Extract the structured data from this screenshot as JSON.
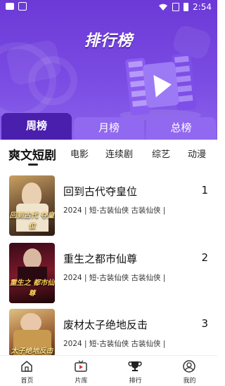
{
  "status_bar": {
    "time": "2:54"
  },
  "header": {
    "title": "排行榜"
  },
  "period_tabs": [
    {
      "label": "周榜",
      "active": true
    },
    {
      "label": "月榜",
      "active": false
    },
    {
      "label": "总榜",
      "active": false
    }
  ],
  "categories": [
    {
      "label": "爽文短剧",
      "active": true
    },
    {
      "label": "电影",
      "active": false
    },
    {
      "label": "连续剧",
      "active": false
    },
    {
      "label": "综艺",
      "active": false
    },
    {
      "label": "动漫",
      "active": false
    }
  ],
  "items": [
    {
      "title": "回到古代夺皇位",
      "rank": "1",
      "meta": "2024 | 短-古装仙侠 古装仙侠 |",
      "poster_text": "回到古代 夺皇位",
      "poster_colors": [
        "#b88a4a",
        "#3a2a1c"
      ]
    },
    {
      "title": "重生之都市仙尊",
      "rank": "2",
      "meta": "2024 | 短-古装仙侠 古装仙侠 |",
      "poster_text": "重生之 都市仙尊",
      "poster_colors": [
        "#5a1a2a",
        "#1a0a12"
      ]
    },
    {
      "title": "废材太子绝地反击",
      "rank": "3",
      "meta": "2024 | 短-古装仙侠 古装仙侠 |",
      "poster_text": "太子绝地反击",
      "poster_colors": [
        "#c8a060",
        "#6a3a20"
      ]
    }
  ],
  "bottom_nav": [
    {
      "label": "首页",
      "icon": "home-icon",
      "active": false
    },
    {
      "label": "片库",
      "icon": "library-icon",
      "active": false
    },
    {
      "label": "排行",
      "icon": "trophy-icon",
      "active": true
    },
    {
      "label": "我的",
      "icon": "profile-icon",
      "active": false
    }
  ],
  "colors": {
    "accent": "#6c39d6",
    "tab_active": "#4a1fae",
    "tab_inactive": "#9168f0"
  }
}
